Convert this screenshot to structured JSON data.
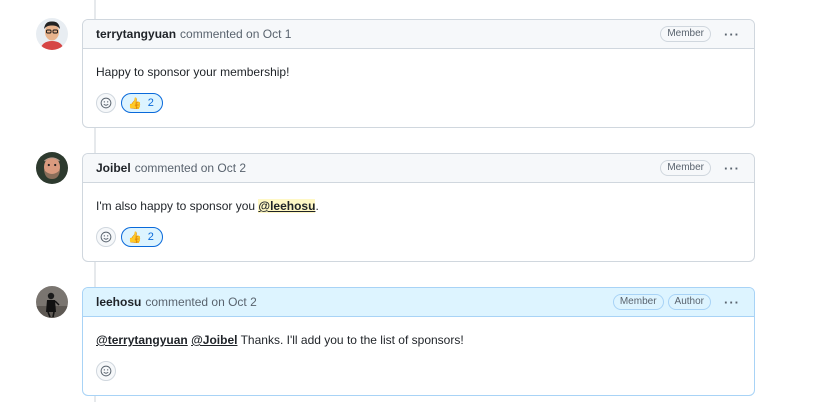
{
  "comments": [
    {
      "author": "terrytangyuan",
      "action": "commented on",
      "date": "Oct 1",
      "badges": [
        "Member"
      ],
      "body": "Happy to sponsor your membership!",
      "reactions": [
        {
          "emoji": "👍",
          "count": "2"
        }
      ],
      "avatar_icon": "user-avatar-terrytangyuan"
    },
    {
      "author": "Joibel",
      "action": "commented on",
      "date": "Oct 2",
      "badges": [
        "Member"
      ],
      "body_prefix": "I'm also happy to sponsor you",
      "body_mention": "@leehosu",
      "body_suffix": ".",
      "reactions": [
        {
          "emoji": "👍",
          "count": "2"
        }
      ],
      "avatar_icon": "user-avatar-joibel"
    },
    {
      "author": "leehosu",
      "action": "commented on",
      "date": "Oct 2",
      "badges": [
        "Member",
        "Author"
      ],
      "mention1": "@terrytangyuan",
      "mention2": "@Joibel",
      "body_suffix": "Thanks. I'll add you to the list of sponsors!",
      "reactions": [],
      "avatar_icon": "user-avatar-leehosu"
    }
  ],
  "more_icon": "kebab-horizontal-icon",
  "smiley_icon": "smiley-icon",
  "colors": {
    "accent": "#0969da",
    "author_header": "#ddf4ff",
    "mention_highlight": "#fff8c5"
  }
}
